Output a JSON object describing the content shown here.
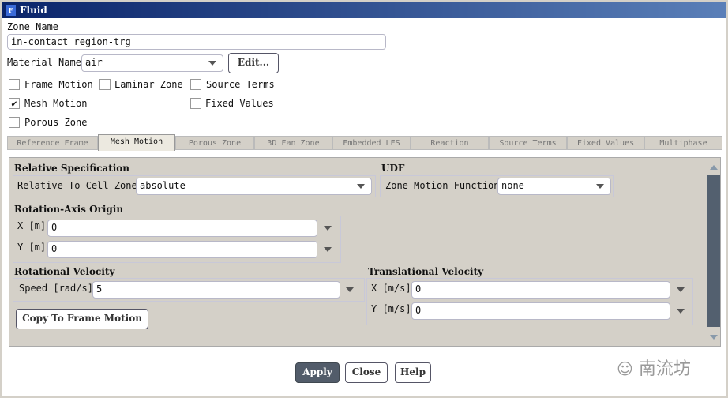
{
  "window": {
    "title": "Fluid",
    "icon_letter": "F"
  },
  "zone_name": {
    "label": "Zone Name",
    "value": "in-contact_region-trg"
  },
  "material": {
    "label": "Material Name",
    "value": "air",
    "edit_label": "Edit..."
  },
  "checkboxes": [
    {
      "label": "Frame Motion",
      "checked": false
    },
    {
      "label": "Laminar Zone",
      "checked": false
    },
    {
      "label": "Source Terms",
      "checked": false
    },
    {
      "label": "Mesh Motion",
      "checked": true
    },
    {
      "label": "Fixed Values",
      "checked": false
    },
    {
      "label": "Porous Zone",
      "checked": false
    }
  ],
  "tabs": [
    "Reference Frame",
    "Mesh Motion",
    "Porous Zone",
    "3D Fan Zone",
    "Embedded LES",
    "Reaction",
    "Source Terms",
    "Fixed Values",
    "Multiphase"
  ],
  "active_tab": "Mesh Motion",
  "panel": {
    "relative_spec": {
      "heading": "Relative Specification",
      "label": "Relative To Cell Zone",
      "value": "absolute"
    },
    "udf": {
      "heading": "UDF",
      "label": "Zone Motion Function",
      "value": "none"
    },
    "origin": {
      "heading": "Rotation-Axis Origin",
      "x_label": "X [m]",
      "x_value": "0",
      "y_label": "Y [m]",
      "y_value": "0"
    },
    "rotational": {
      "heading": "Rotational Velocity",
      "label": "Speed [rad/s]",
      "value": "5",
      "copy_label": "Copy To Frame Motion"
    },
    "translational": {
      "heading": "Translational Velocity",
      "x_label": "X [m/s]",
      "x_value": "0",
      "y_label": "Y [m/s]",
      "y_value": "0"
    }
  },
  "buttons": {
    "apply": "Apply",
    "close": "Close",
    "help": "Help"
  },
  "watermark": "南流坊"
}
